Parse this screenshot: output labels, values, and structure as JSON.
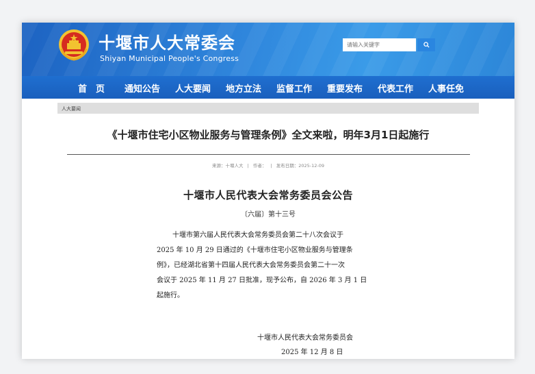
{
  "header": {
    "title": "十堰市人大常委会",
    "subtitle": "Shiyan Municipal People's Congress",
    "search_placeholder": "请输入关键字",
    "colors": {
      "brand_blue": "#1f6fd0",
      "emblem_red": "#d62b1f",
      "emblem_gold": "#f2c230"
    }
  },
  "nav": {
    "items": [
      {
        "label": "首　页"
      },
      {
        "label": "通知公告"
      },
      {
        "label": "人大要闻"
      },
      {
        "label": "地方立法"
      },
      {
        "label": "监督工作"
      },
      {
        "label": "重要发布"
      },
      {
        "label": "代表工作"
      },
      {
        "label": "人事任免"
      }
    ]
  },
  "breadcrumb": "人大要闻",
  "article": {
    "title": "《十堰市住宅小区物业服务与管理条例》全文来啦，明年3月1日起施行",
    "meta": {
      "source": "来源：十堰人大",
      "separator": "|",
      "author": "作者：",
      "date": "发布日期：2025-12-09"
    },
    "notice_title": "十堰市人民代表大会常务委员会公告",
    "notice_number": "〔六届〕第十三号",
    "body_lines": [
      "十堰市第六届人民代表大会常务委员会第二十八次会议于",
      "2025 年 10 月 29 日通过的《十堰市住宅小区物业服务与管理条",
      "例》，已经湖北省第十四届人民代表大会常务委员会第二十一次",
      "会议于 2025 年 11 月 27 日批准，现予公布，自 2026 年 3 月 1 日",
      "起施行。"
    ],
    "signature": "十堰市人民代表大会常务委员会",
    "sign_date": "2025 年 12 月 8 日"
  }
}
